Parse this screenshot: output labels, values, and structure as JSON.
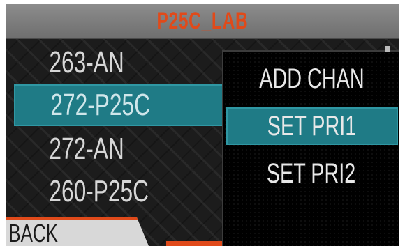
{
  "title": "P25C_LAB",
  "channels": [
    {
      "label": "263-AN",
      "selected": false
    },
    {
      "label": "272-P25C",
      "selected": true
    },
    {
      "label": "272-AN",
      "selected": false
    },
    {
      "label": "260-P25C",
      "selected": false
    }
  ],
  "menu": {
    "items": [
      {
        "label": "ADD CHAN",
        "selected": false
      },
      {
        "label": "SET PRI1",
        "selected": true
      },
      {
        "label": "SET PRI2",
        "selected": false
      }
    ]
  },
  "back_button": {
    "label": "BACK"
  },
  "colors": {
    "title_text": "#e04a1a",
    "selection_bg": "#1f7b86",
    "accent": "#e04a1a"
  }
}
